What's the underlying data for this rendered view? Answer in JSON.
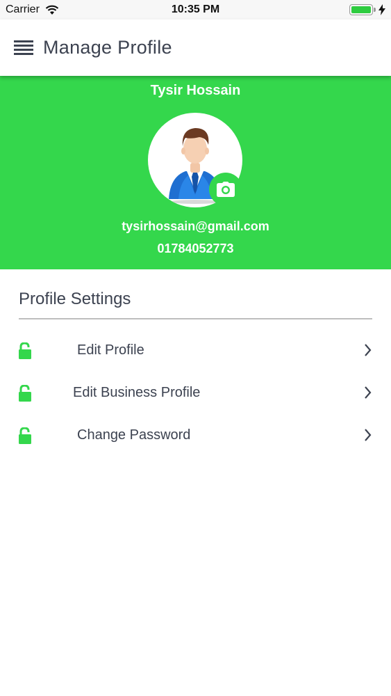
{
  "status_bar": {
    "carrier": "Carrier",
    "time": "10:35 PM",
    "battery_color": "#2ecc40"
  },
  "header": {
    "title": "Manage Profile",
    "menu_icon": "hamburger-menu-icon"
  },
  "profile": {
    "name": "Tysir Hossain",
    "email": "tysirhossain@gmail.com",
    "phone": "01784052773",
    "banner_color": "#34d74c",
    "avatar_icon": "businessman-avatar-icon",
    "camera_icon": "camera-icon"
  },
  "settings": {
    "heading": "Profile Settings",
    "items": [
      {
        "label": "Edit Profile",
        "icon": "unlock-icon",
        "chevron": "chevron-right-icon"
      },
      {
        "label": "Edit Business Profile",
        "icon": "unlock-icon",
        "chevron": "chevron-right-icon"
      },
      {
        "label": "Change Password",
        "icon": "unlock-icon",
        "chevron": "chevron-right-icon"
      }
    ]
  }
}
